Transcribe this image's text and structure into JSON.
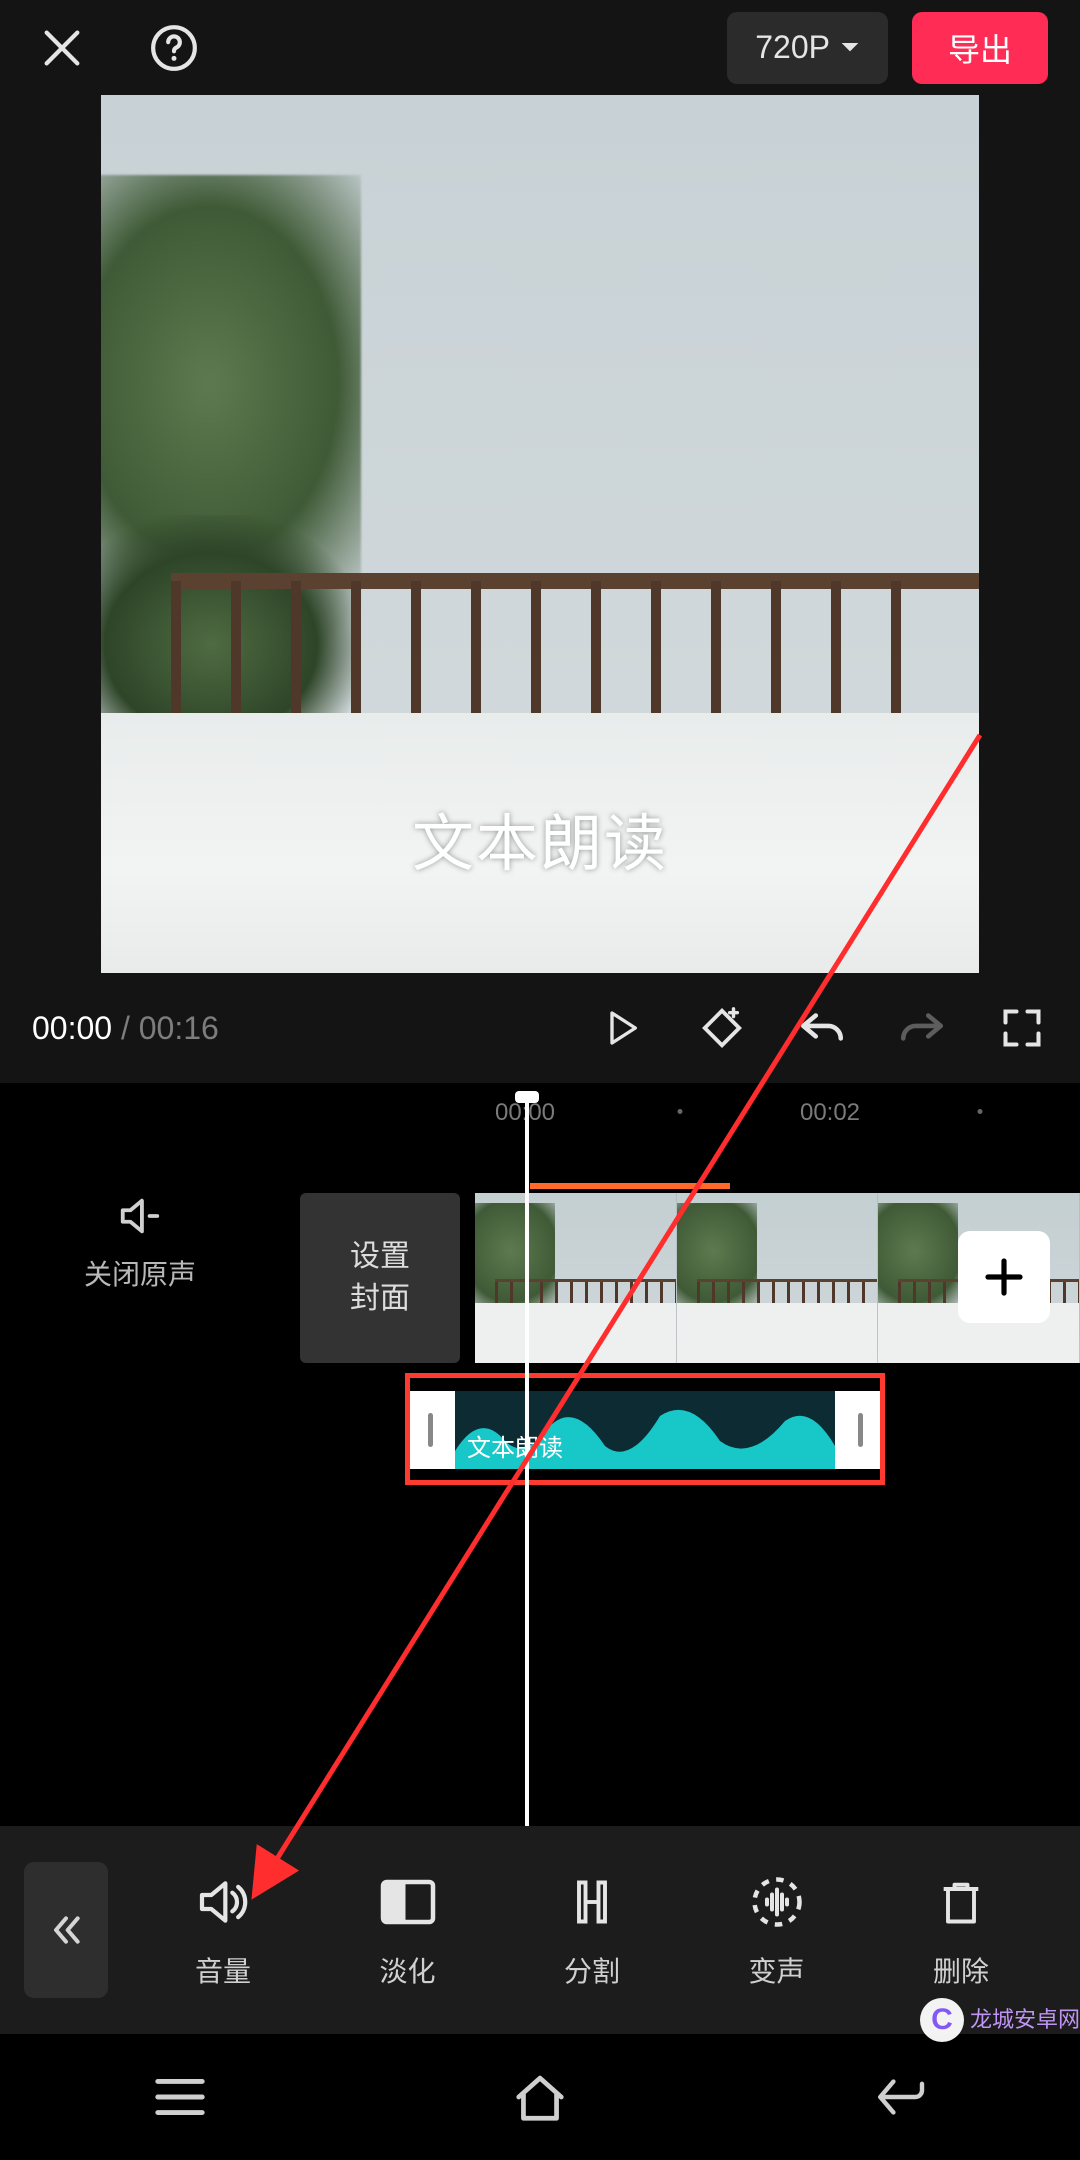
{
  "header": {
    "resolution_label": "720P",
    "export_label": "导出"
  },
  "preview": {
    "caption": "文本朗读"
  },
  "playbar": {
    "current_time": "00:00",
    "total_time": "00:16"
  },
  "timeline": {
    "ruler": [
      "00:00",
      "00:02"
    ],
    "mute_label": "关闭原声",
    "cover_label_line1": "设置",
    "cover_label_line2": "封面",
    "audio_clip_label": "文本朗读"
  },
  "toolbar": {
    "items": [
      {
        "id": "volume",
        "label": "音量"
      },
      {
        "id": "fade",
        "label": "淡化"
      },
      {
        "id": "split",
        "label": "分割"
      },
      {
        "id": "voice",
        "label": "变声"
      },
      {
        "id": "delete",
        "label": "删除"
      }
    ]
  },
  "watermark": {
    "badge": "C",
    "text": "龙城安卓网"
  }
}
